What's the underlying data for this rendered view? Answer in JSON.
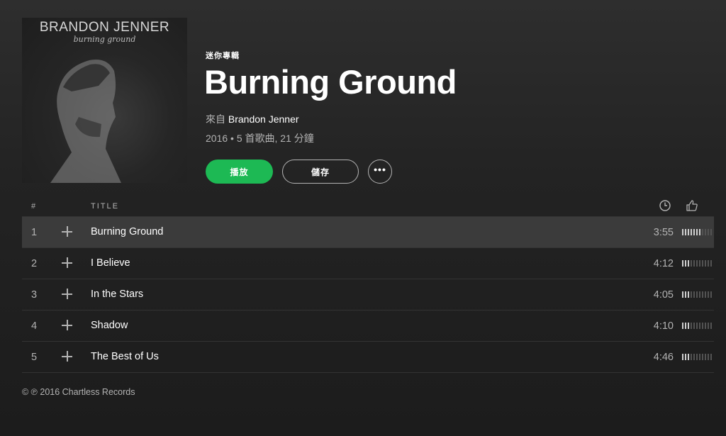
{
  "album": {
    "cover_artist_text": "BRANDON JENNER",
    "cover_script_text": "burning ground",
    "type_label": "迷你專輯",
    "title": "Burning Ground",
    "by_prefix": "來自",
    "artist": "Brandon Jenner",
    "meta": "2016 • 5 首歌曲, 21 分鐘"
  },
  "actions": {
    "play_label": "播放",
    "save_label": "儲存",
    "more_label": "•••"
  },
  "table": {
    "col_number": "#",
    "col_title": "TITLE",
    "col_duration_icon": "clock-icon",
    "col_popularity_icon": "thumbs-up-icon"
  },
  "tracks": [
    {
      "number": "1",
      "title": "Burning Ground",
      "duration": "3:55",
      "popularity": 0.6
    },
    {
      "number": "2",
      "title": "I Believe",
      "duration": "4:12",
      "popularity": 0.3
    },
    {
      "number": "3",
      "title": "In the Stars",
      "duration": "4:05",
      "popularity": 0.3
    },
    {
      "number": "4",
      "title": "Shadow",
      "duration": "4:10",
      "popularity": 0.3
    },
    {
      "number": "5",
      "title": "The Best of Us",
      "duration": "4:46",
      "popularity": 0.3
    }
  ],
  "footer": {
    "copyright": "© ℗ 2016 Chartless Records"
  },
  "colors": {
    "accent": "#1db954",
    "background": "#1c1c1c",
    "text_secondary": "#b3b3b3"
  }
}
